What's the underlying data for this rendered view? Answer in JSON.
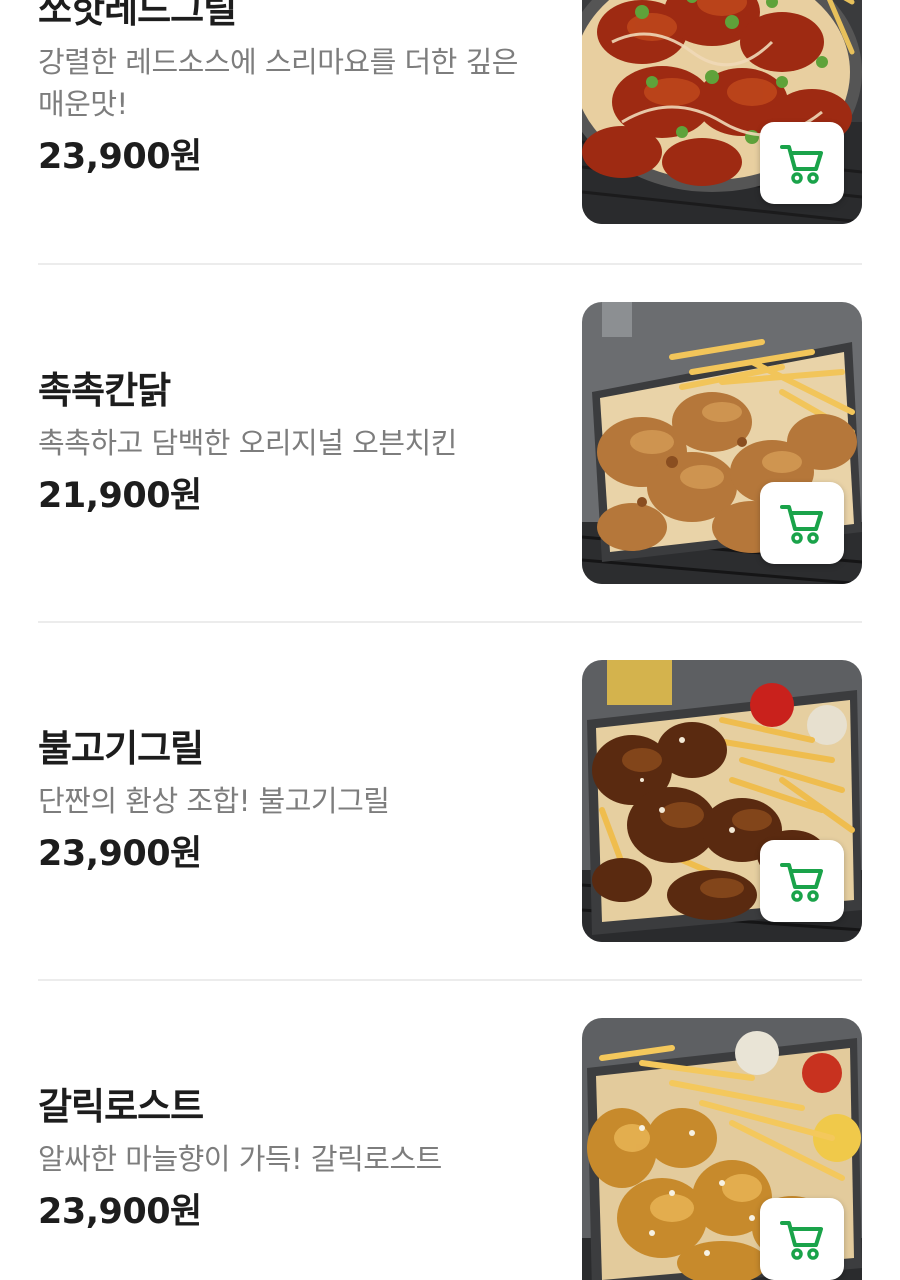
{
  "menu": {
    "items": [
      {
        "name": "쏘핫레드그릴",
        "description": "강렬한 레드소스에 스리마요를 더한 깊은 매운맛!",
        "price": "23,900원",
        "image_icon": "spicy-red-grill-chicken-image"
      },
      {
        "name": "촉촉칸닭",
        "description": "촉촉하고 담백한 오리지널 오븐치킨",
        "price": "21,900원",
        "image_icon": "roast-chicken-fries-image"
      },
      {
        "name": "불고기그릴",
        "description": "단짠의 환상 조합! 불고기그릴",
        "price": "23,900원",
        "image_icon": "bulgogi-grill-chicken-image"
      },
      {
        "name": "갈릭로스트",
        "description": "알싸한 마늘향이 가득! 갈릭로스트",
        "price": "23,900원",
        "image_icon": "garlic-roast-chicken-image"
      }
    ],
    "cart_icon": "shopping-cart-icon"
  },
  "colors": {
    "accent_green": "#1aa34a",
    "title_text": "#1d1d1d",
    "description_text": "#7d7d7d",
    "divider": "#ececec"
  }
}
